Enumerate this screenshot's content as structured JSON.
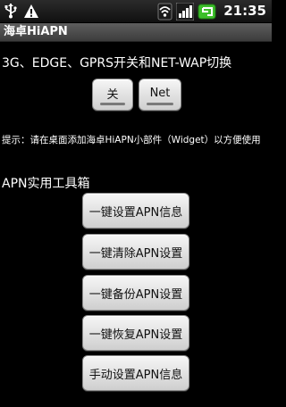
{
  "status_bar": {
    "icons": [
      "usb-icon",
      "warning-icon",
      "wifi-icon",
      "signal-icon",
      "battery-charging-icon"
    ],
    "time": "21:35"
  },
  "app": {
    "title": "海卓HiAPN"
  },
  "network_section": {
    "heading": "3G、EDGE、GPRS开关和NET-WAP切换",
    "off_button": "关",
    "net_button": "Net"
  },
  "tip": {
    "text": "提示：请在桌面添加海卓HiAPN小部件（Widget）以方便使用"
  },
  "toolbox": {
    "heading": "APN实用工具箱",
    "buttons": [
      "一键设置APN信息",
      "一键清除APN设置",
      "一键备份APN设置",
      "一键恢复APN设置",
      "手动设置APN信息"
    ]
  },
  "colors": {
    "background": "#000000",
    "title_bar": "#4a4a4a",
    "button_face": "#e4e4e4",
    "battery_green": "#3cbf2a"
  }
}
